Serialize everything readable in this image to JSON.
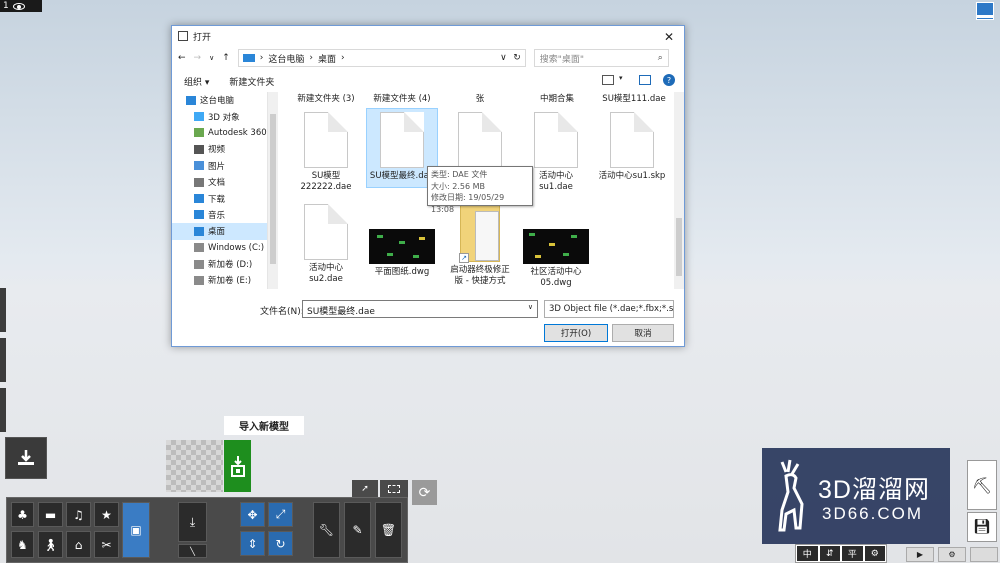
{
  "top_left": {
    "label": "1"
  },
  "dialog": {
    "title": "打开",
    "address": [
      "这台电脑",
      "桌面"
    ],
    "search_placeholder": "搜索\"桌面\"",
    "toolbar": {
      "organize": "组织 ▾",
      "new_folder": "新建文件夹"
    },
    "nav_items": [
      {
        "label": "这台电脑",
        "icon": "computer-icon"
      },
      {
        "label": "3D 对象",
        "icon": "cube-icon"
      },
      {
        "label": "Autodesk 360",
        "icon": "cloud-icon"
      },
      {
        "label": "视频",
        "icon": "video-icon"
      },
      {
        "label": "图片",
        "icon": "image-icon"
      },
      {
        "label": "文档",
        "icon": "document-icon"
      },
      {
        "label": "下载",
        "icon": "download-icon"
      },
      {
        "label": "音乐",
        "icon": "music-icon"
      },
      {
        "label": "桌面",
        "icon": "desktop-icon"
      },
      {
        "label": "Windows (C:)",
        "icon": "drive-icon"
      },
      {
        "label": "新加卷 (D:)",
        "icon": "drive-icon"
      },
      {
        "label": "新加卷 (E:)",
        "icon": "drive-icon"
      }
    ],
    "folder_headers": [
      "新建文件夹 (3)",
      "新建文件夹 (4)",
      "张",
      "中期合集",
      "SU模型111.dae"
    ],
    "files": [
      {
        "label": "SU模型\n222222.dae"
      },
      {
        "label": "SU模型最终.dae"
      },
      {
        "label": ""
      },
      {
        "label": "活动中心\nsu1.dae"
      },
      {
        "label": "活动中心su1.skp"
      },
      {
        "label": "活动中心\nsu2.dae"
      },
      {
        "label": "平面图纸.dwg"
      },
      {
        "label": "启动器终极修正\n版 - 快捷方式"
      },
      {
        "label": "社区活动中心\n05.dwg"
      }
    ],
    "tooltip": {
      "type": "类型: DAE 文件",
      "size": "大小: 2.56 MB",
      "date": "修改日期: 19/05/29 13:08"
    },
    "filename_label": "文件名(N):",
    "filename_value": "SU模型最终.dae",
    "filetype": "3D Object file (*.dae;*.fbx;*.s",
    "open_button": "打开(O)",
    "cancel_button": "取消"
  },
  "import_label": "导入新模型",
  "watermark": {
    "line1": "3D溜溜网",
    "line2": "3D66.COM"
  },
  "bottom_right_buttons": [
    "中",
    "平"
  ]
}
